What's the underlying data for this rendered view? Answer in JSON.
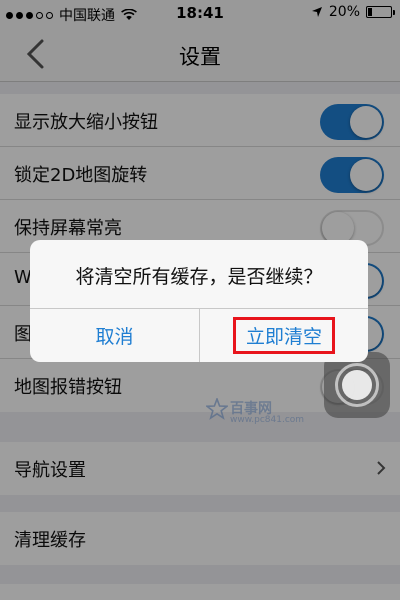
{
  "status_bar": {
    "carrier": "中国联通",
    "time": "18:41",
    "battery": "20%",
    "battery_level": 0.2
  },
  "nav": {
    "title": "设置",
    "back_icon": "chevron-left-icon"
  },
  "settings": [
    {
      "label": "显示放大缩小按钮",
      "toggle": true
    },
    {
      "label": "锁定2D地图旋转",
      "toggle": true
    },
    {
      "label": "保持屏幕常亮",
      "toggle": false
    },
    {
      "label": "W",
      "toggle": true
    },
    {
      "label": "图",
      "toggle": true
    },
    {
      "label": "地图报错按钮",
      "toggle": false
    }
  ],
  "navigation_settings": {
    "label": "导航设置"
  },
  "clear_cache": {
    "label": "清理缓存"
  },
  "dialog": {
    "message": "将清空所有缓存，是否继续？",
    "cancel": "取消",
    "confirm": "立即清空"
  },
  "watermark": {
    "name": "百事网",
    "url": "www.pc841.com"
  },
  "colors": {
    "accent": "#1f7ed2",
    "highlight": "#e8141c"
  }
}
